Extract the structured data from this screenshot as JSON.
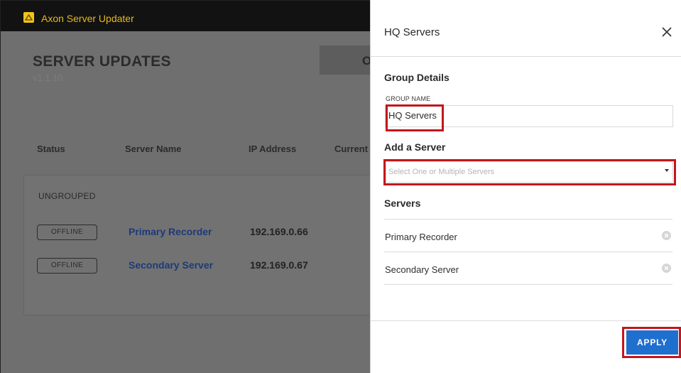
{
  "app": {
    "title": "Axon Server Updater",
    "page_title": "SERVER UPDATES",
    "version": "v1.1.10",
    "top_button_label": "O",
    "columns": [
      "Status",
      "Server Name",
      "IP Address",
      "Current"
    ],
    "group_label": "UNGROUPED",
    "rows": [
      {
        "status": "OFFLINE",
        "name": "Primary Recorder",
        "ip": "192.169.0.66"
      },
      {
        "status": "OFFLINE",
        "name": "Secondary Server",
        "ip": "192.169.0.67"
      }
    ]
  },
  "drawer": {
    "title": "HQ Servers",
    "group_details_heading": "Group Details",
    "group_name_label": "GROUP NAME",
    "group_name_value": "HQ Servers",
    "add_server_heading": "Add a Server",
    "add_server_placeholder": "Select One or Multiple Servers",
    "servers_heading": "Servers",
    "servers": [
      {
        "name": "Primary Recorder"
      },
      {
        "name": "Secondary Server"
      }
    ],
    "apply_label": "APPLY"
  },
  "colors": {
    "accent": "#1f6fcf",
    "highlight": "#c4161c",
    "title_accent": "#e8b819"
  },
  "icons": {
    "app": "axon-logo-icon",
    "close": "close-icon",
    "remove": "remove-circle-icon",
    "dropdown": "chevron-down-icon"
  }
}
